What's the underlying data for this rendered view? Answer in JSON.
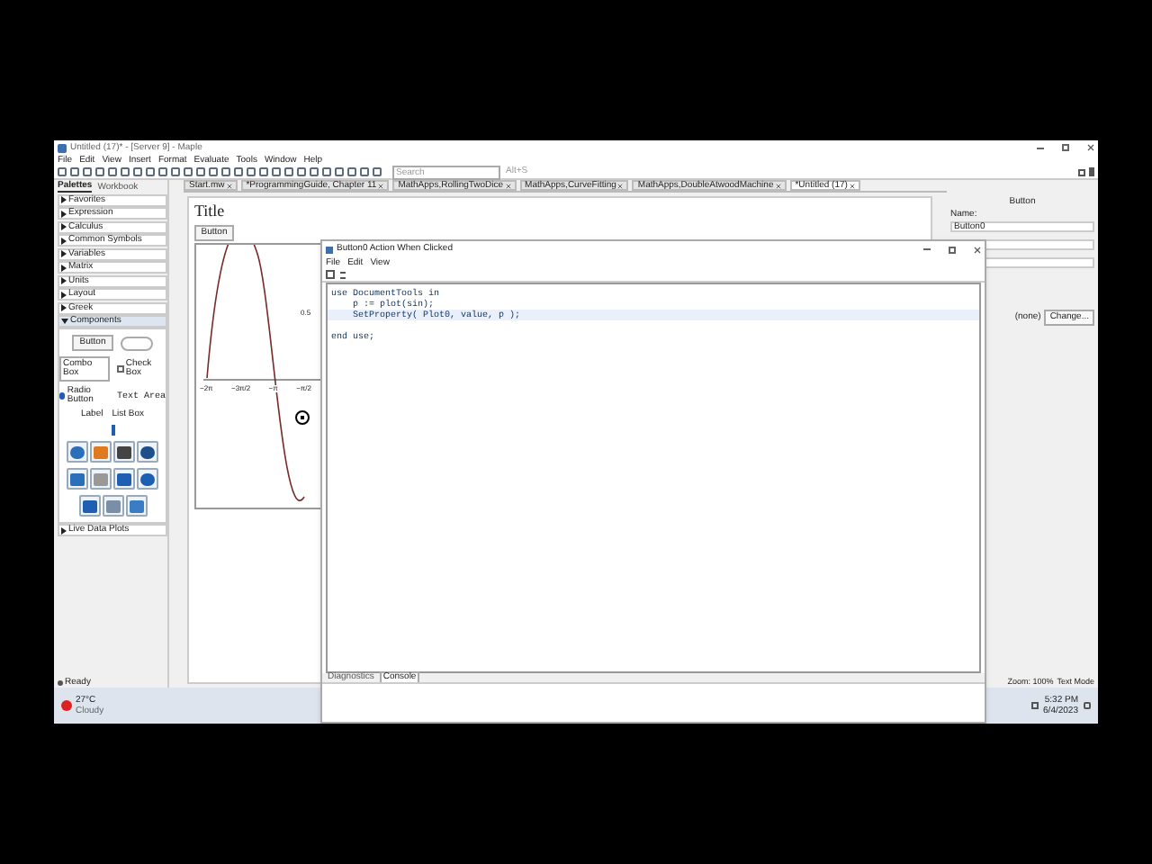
{
  "window": {
    "title": "Untitled (17)* - [Server 9] - Maple"
  },
  "menu": [
    "File",
    "Edit",
    "View",
    "Insert",
    "Format",
    "Evaluate",
    "Tools",
    "Window",
    "Help"
  ],
  "search": {
    "placeholder": "Search",
    "shortcut": "Alt+S"
  },
  "doc_tabs": [
    {
      "label": "Start.mw",
      "selected": false
    },
    {
      "label": "*ProgrammingGuide, Chapter 11",
      "selected": false
    },
    {
      "label": "MathApps,RollingTwoDice",
      "selected": false
    },
    {
      "label": "MathApps,CurveFitting",
      "selected": false
    },
    {
      "label": "MathApps,DoubleAtwoodMachine",
      "selected": false
    },
    {
      "label": "*Untitled (17)",
      "selected": true
    }
  ],
  "palettes": {
    "tabs": [
      {
        "label": "Palettes",
        "selected": true
      },
      {
        "label": "Workbook",
        "selected": false
      }
    ],
    "sections": [
      {
        "label": "Favorites",
        "expanded": false
      },
      {
        "label": "Expression",
        "expanded": false
      },
      {
        "label": "Calculus",
        "expanded": false
      },
      {
        "label": "Common Symbols",
        "expanded": false
      },
      {
        "label": "Variables",
        "expanded": false
      },
      {
        "label": "Matrix",
        "expanded": false
      },
      {
        "label": "Units",
        "expanded": false
      },
      {
        "label": "Layout",
        "expanded": false
      },
      {
        "label": "Greek",
        "expanded": false
      },
      {
        "label": "Components",
        "expanded": true
      }
    ],
    "components": {
      "button": "Button",
      "combo": "Combo Box",
      "check": "Check Box",
      "radio": "Radio Button",
      "text": "Text",
      "area": "Area",
      "label": "Label",
      "list": "List Box"
    },
    "more": {
      "label": "Live Data Plots",
      "expanded": false
    }
  },
  "document": {
    "title": "Title",
    "button": "Button",
    "x_ticks": [
      "−2π",
      "−3π/2",
      "−π",
      "−π/2"
    ],
    "y_tick": "0.5"
  },
  "context": {
    "heading": "Button",
    "name_label": "Name:",
    "name_value": "Button0",
    "image_value": "(none)",
    "change": "Change..."
  },
  "status": {
    "ready": "Ready",
    "zoom": "Zoom: 100%",
    "mode": "Text Mode"
  },
  "taskbar": {
    "temp": "27°C",
    "weather": "Cloudy",
    "time": "5:32 PM",
    "date": "6/4/2023"
  },
  "dialog": {
    "title": "Button0 Action When Clicked",
    "menu": [
      "File",
      "Edit",
      "View"
    ],
    "code": [
      {
        "text": "use DocumentTools in",
        "selected": false
      },
      {
        "text": "    p := plot(sin);",
        "selected": false
      },
      {
        "text": "    SetProperty( Plot0, value, p );",
        "selected": true
      },
      {
        "selected": false
      },
      {
        "text": "end use;",
        "selected": false
      }
    ],
    "tabs": [
      {
        "label": "Diagnostics",
        "selected": false
      },
      {
        "label": "Console",
        "selected": true
      }
    ]
  }
}
